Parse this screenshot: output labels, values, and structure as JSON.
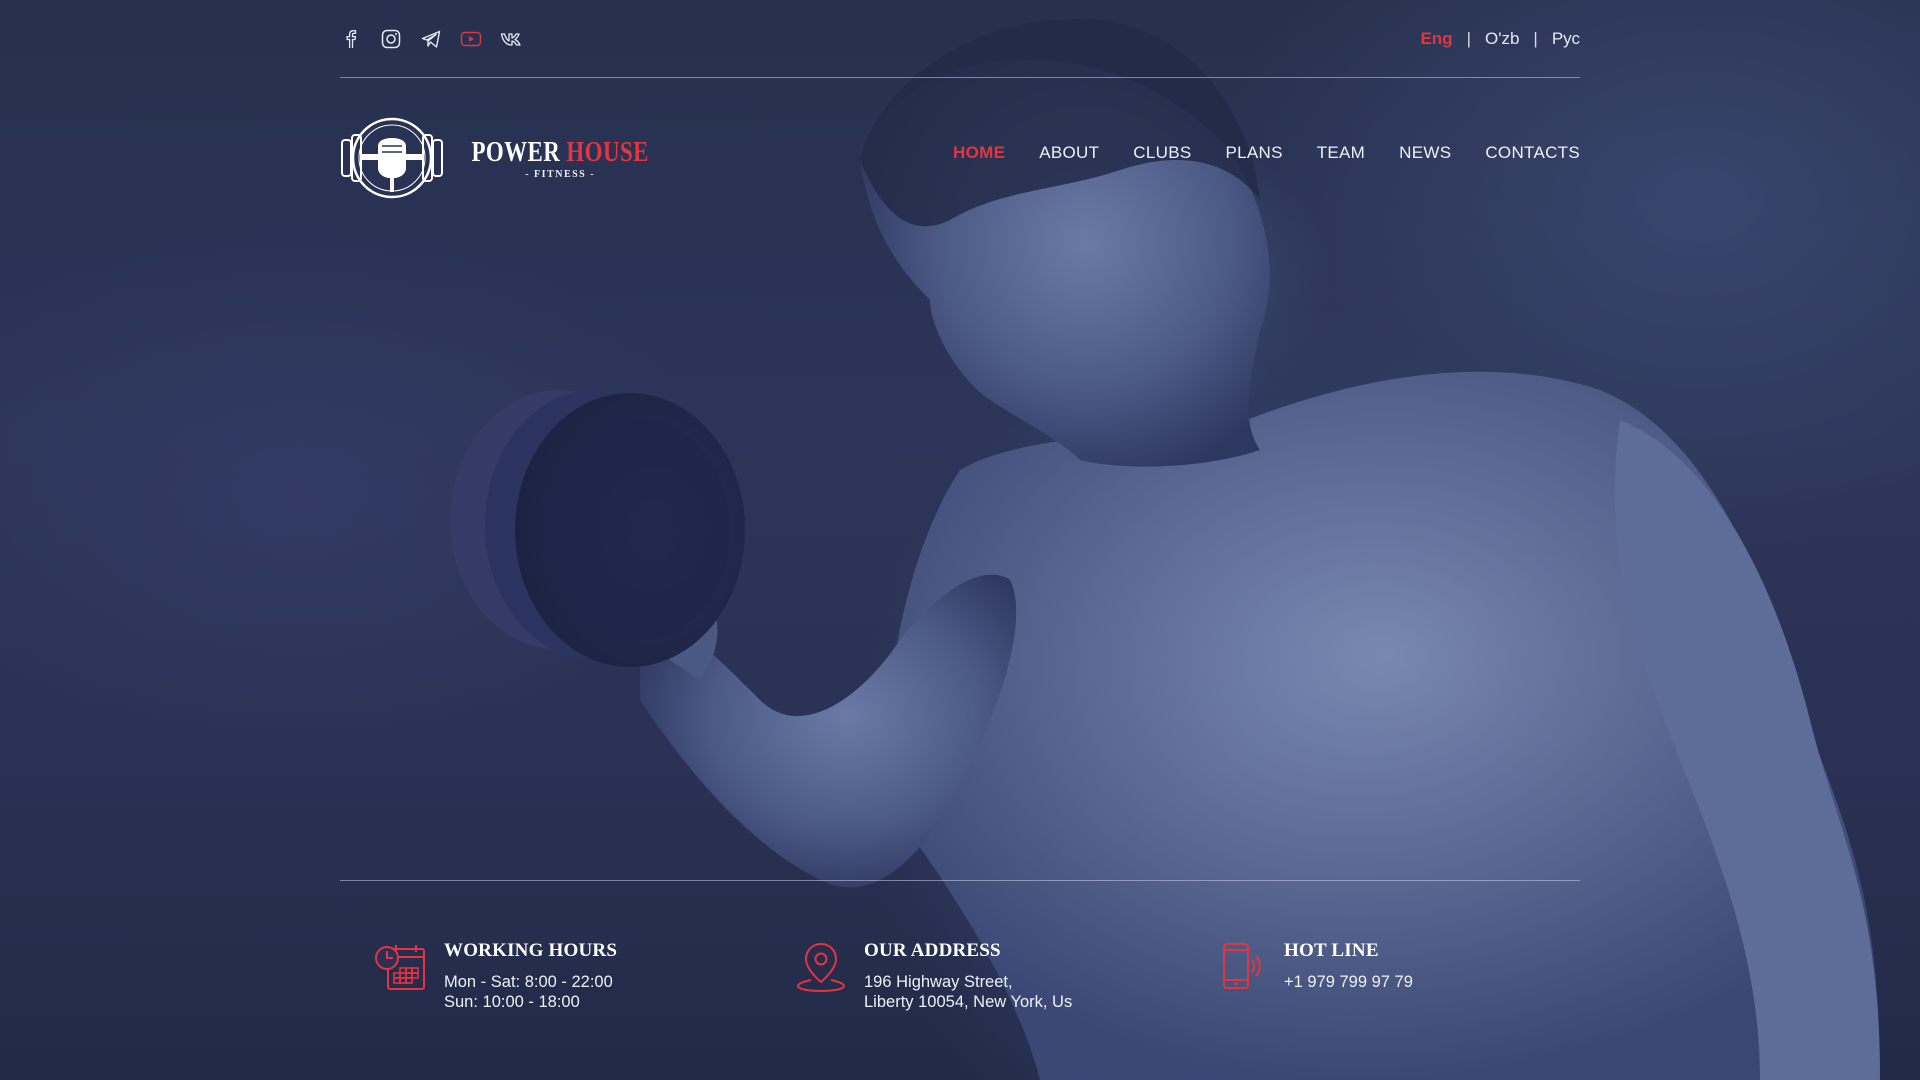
{
  "socials": [
    {
      "name": "facebook-icon"
    },
    {
      "name": "instagram-icon"
    },
    {
      "name": "telegram-icon"
    },
    {
      "name": "youtube-icon"
    },
    {
      "name": "vk-icon"
    }
  ],
  "languages": {
    "items": [
      "Eng",
      "O'zb",
      "Рус"
    ],
    "separator": "|",
    "active": "Eng"
  },
  "logo": {
    "word1": "POWER",
    "word2": "HOUSE",
    "subtitle": "- FITNESS -"
  },
  "nav": {
    "items": [
      "HOME",
      "ABOUT",
      "CLUBS",
      "PLANS",
      "TEAM",
      "NEWS",
      "CONTACTS"
    ],
    "active": "HOME"
  },
  "info": {
    "hours": {
      "title": "WORKING HOURS",
      "line1": "Mon - Sat: 8:00 - 22:00",
      "line2": "Sun: 10:00 - 18:00"
    },
    "address": {
      "title": "OUR ADDRESS",
      "line1": "196 Highway Street,",
      "line2": "Liberty 10054, New York, Us"
    },
    "hotline": {
      "title": "HOT LINE",
      "line1": "+1 979 799 97 79"
    }
  },
  "colors": {
    "accent": "#e3343f",
    "background": "#2a3154",
    "text": "#eef0f6"
  }
}
